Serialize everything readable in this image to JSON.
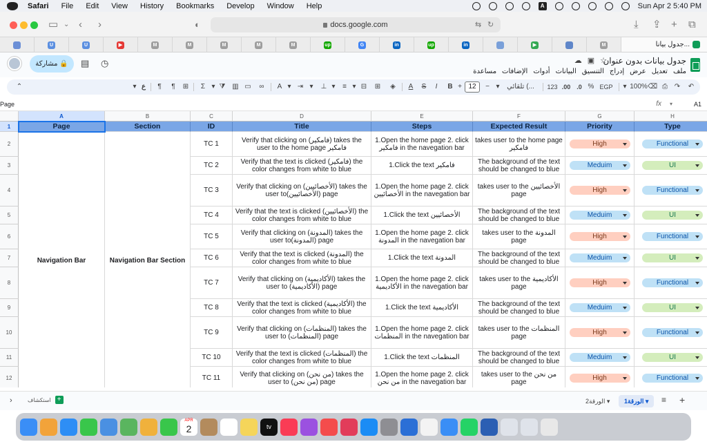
{
  "menubar": {
    "app": "Safari",
    "items": [
      "File",
      "Edit",
      "View",
      "History",
      "Bookmarks",
      "Develop",
      "Window",
      "Help"
    ],
    "clock": "Sun Apr 2  5:40 PM",
    "input_badge": "A"
  },
  "safari": {
    "url": "docs.google.com",
    "active_tab_title": "جدول بيانا..."
  },
  "favorites": [
    {
      "icon": "slack-icon",
      "letter": "",
      "color": "#6b8fd6"
    },
    {
      "icon": "u-icon",
      "letter": "U",
      "color": "#5b8fe0"
    },
    {
      "icon": "u-icon",
      "letter": "U",
      "color": "#5b8fe0"
    },
    {
      "icon": "youtube-icon",
      "letter": "▶",
      "color": "#e53935"
    },
    {
      "icon": "m-icon",
      "letter": "M",
      "color": "#9e9e9e"
    },
    {
      "icon": "m-icon",
      "letter": "M",
      "color": "#9e9e9e"
    },
    {
      "icon": "m-icon",
      "letter": "M",
      "color": "#9e9e9e"
    },
    {
      "icon": "m-icon",
      "letter": "M",
      "color": "#9e9e9e"
    },
    {
      "icon": "m-icon",
      "letter": "M",
      "color": "#9e9e9e"
    },
    {
      "icon": "upwork-icon",
      "letter": "up",
      "color": "#14a800"
    },
    {
      "icon": "google-icon",
      "letter": "G",
      "color": "#4285f4"
    },
    {
      "icon": "linkedin-icon",
      "letter": "in",
      "color": "#0a66c2"
    },
    {
      "icon": "upwork-icon",
      "letter": "up",
      "color": "#14a800"
    },
    {
      "icon": "linkedin-icon",
      "letter": "in",
      "color": "#0a66c2"
    },
    {
      "icon": "bird-icon",
      "letter": "",
      "color": "#7aa0d9"
    },
    {
      "icon": "play-icon",
      "letter": "▶",
      "color": "#34a853"
    },
    {
      "icon": "puzzle-icon",
      "letter": "",
      "color": "#5f86c9"
    },
    {
      "icon": "m-icon",
      "letter": "M",
      "color": "#9e9e9e"
    }
  ],
  "sheets": {
    "doc_title": "جدول بيانات بدون عنوان",
    "menus": [
      "ملف",
      "تعديل",
      "عرض",
      "إدراج",
      "التنسيق",
      "البيانات",
      "أدوات",
      "الإضافات",
      "مساعدة"
    ],
    "share_label": "مشاركة",
    "toolbar": {
      "zoom": "100%",
      "currency": "EGP",
      "percent": "%",
      "dec_minus": ".0",
      "dec_plus": ".00",
      "number_fmt": "123",
      "font": "تلقائي (...",
      "font_size": "12",
      "bold": "B",
      "italic": "I"
    },
    "name_box": "A1",
    "fx": "fx",
    "formula_content": "Page"
  },
  "grid": {
    "columns": [
      "A",
      "B",
      "C",
      "D",
      "E",
      "F",
      "G",
      "H"
    ],
    "header_row": [
      "Page",
      "Section",
      "ID",
      "Title",
      "Steps",
      "Expected Result",
      "Priority",
      "Type"
    ],
    "merged_page": "Navigation Bar",
    "merged_section": "Navigation Bar Section",
    "rows": [
      {
        "num": "2",
        "id": "TC 1",
        "title": "Verify that clicking on (فامكير) takes the user to the home page فامكير",
        "steps": "1.Open the home page 2. click فامكير in the navegation bar",
        "expected": "takes user to the home page فامكير",
        "priority": "High",
        "type": "Functional"
      },
      {
        "num": "3",
        "id": "TC 2",
        "title": "Verify that the text is clicked (فامكير) the color changes from white to blue",
        "steps": "1.Click the text فامكير",
        "expected": "The background of the text should be changed to blue",
        "priority": "Meduim",
        "type": "UI"
      },
      {
        "num": "4",
        "id": "TC 3",
        "title": "Verify that clicking on (الأخصائيين) takes the user to(الأخصائيين) page",
        "steps": "1.Open the home page 2. click الأخصائيين in the navegation bar",
        "expected": "takes user to the الأخصائيين page",
        "priority": "High",
        "type": "Functional"
      },
      {
        "num": "5",
        "id": "TC 4",
        "title": "Verify that the text is clicked (الأخصائيين) the color changes from white to blue",
        "steps": "1.Click the text الأخصائيين",
        "expected": "The background of the text should be changed to blue",
        "priority": "Meduim",
        "type": "UI"
      },
      {
        "num": "6",
        "id": "TC 5",
        "title": "Verify that clicking on (المدونة) takes the user to(المدونة) page",
        "steps": "1.Open the home page 2. click المدونة in the navegation bar",
        "expected": "takes user to the المدونة page",
        "priority": "High",
        "type": "Functional"
      },
      {
        "num": "7",
        "id": "TC 6",
        "title": "Verify that the text is clicked (المدونة) the color changes from white to blue",
        "steps": "1.Click the text المدونة",
        "expected": "The background of the text should be changed to blue",
        "priority": "Meduim",
        "type": "UI"
      },
      {
        "num": "8",
        "id": "TC 7",
        "title": "Verify that clicking on (الأكاديمية) takes the user to (الأكاديمية) page",
        "steps": "1.Open the home page 2. click الأكاديمية in the navegation bar",
        "expected": "takes user to the الأكاديمية page",
        "priority": "High",
        "type": "Functional"
      },
      {
        "num": "9",
        "id": "TC 8",
        "title": "Verify that the text is clicked (الأكاديمية) the color changes from white to blue",
        "steps": "1.Click the text الأكاديمية",
        "expected": "The background of the text should be changed to blue",
        "priority": "Meduim",
        "type": "UI"
      },
      {
        "num": "10",
        "id": "TC 9",
        "title": "Verify that clicking on (المنظمات) takes the user to (المنظمات) page",
        "steps": "1.Open the home page 2. click المنظمات in the navegation bar",
        "expected": "takes user to the المنظمات page",
        "priority": "High",
        "type": "Functional"
      },
      {
        "num": "11",
        "id": "TC 10",
        "title": "Verify that the text is clicked (المنظمات) the color changes from white to blue",
        "steps": "1.Click the text المنظمات",
        "expected": "The background of the text should be changed to blue",
        "priority": "Meduim",
        "type": "UI"
      },
      {
        "num": "12",
        "id": "TC 11",
        "title": "Verify that clicking on (من نحن) takes the user to (من نحن) page",
        "steps": "1.Open the home page 2. click من نحن in the navegation bar",
        "expected": "takes user to the من نحن page",
        "priority": "High",
        "type": "Functional"
      }
    ]
  },
  "sheet_tabs": {
    "explore": "استكشاف",
    "tabs": [
      "الورقة1",
      "الورقة2"
    ]
  },
  "dock": [
    "finder-icon",
    "launchpad-icon",
    "safari-icon",
    "messages-icon",
    "mail-icon",
    "maps-icon",
    "photos-icon",
    "facetime-icon",
    "calendar-icon",
    "contacts-icon",
    "reminders-icon",
    "notes-icon",
    "tv-icon",
    "music-icon",
    "podcasts-icon",
    "news-icon",
    "creative-cloud-icon",
    "appstore-icon",
    "settings-icon",
    "xcode-icon",
    "preview-icon",
    "finder2-icon",
    "whatsapp-icon",
    "word-icon",
    "files-icon",
    "downloads-icon",
    "trash-icon"
  ],
  "dock_calendar": {
    "month": "APR",
    "day": "2"
  },
  "dock_tv": "tv"
}
